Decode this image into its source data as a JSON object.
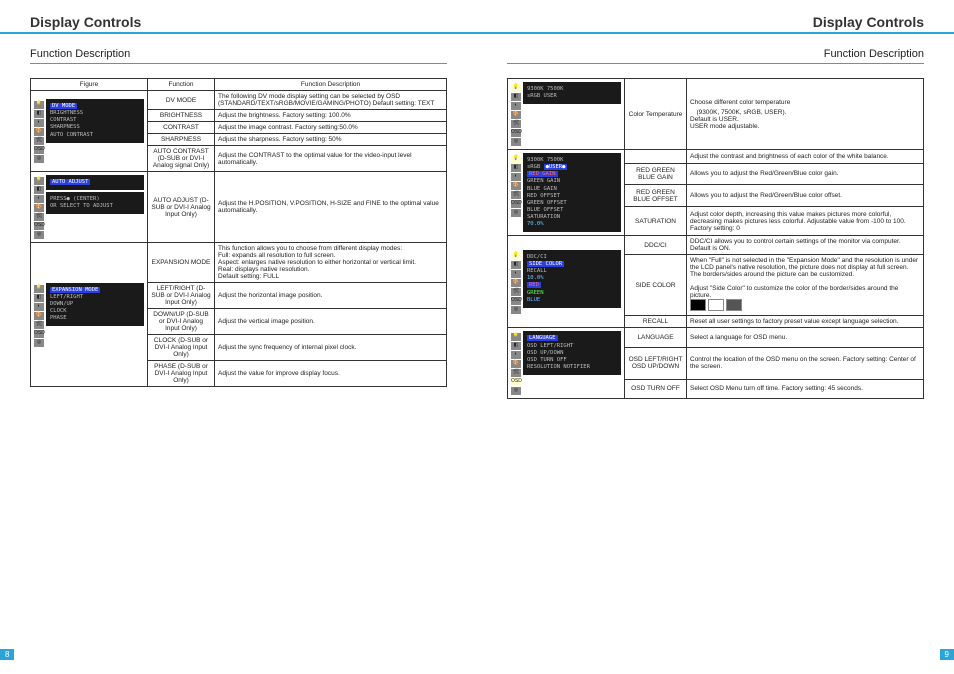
{
  "left": {
    "title": "Display Controls",
    "sub": "Function Description",
    "pnum": "8",
    "headers": [
      "Figure",
      "Function",
      "Function Description"
    ],
    "rows": [
      {
        "fn": "DV MODE",
        "desc": "The following DV mode display setting can be selected by OSD (STANDARD/TEXT/sRGB/MOVIE/GAMING/PHOTO) Default setting: TEXT"
      },
      {
        "fn": "BRIGHTNESS",
        "desc": "Adjust the brightness. Factory setting: 100.0%"
      },
      {
        "fn": "CONTRAST",
        "desc": "Adjust the image contrast. Factory setting:50.0%"
      },
      {
        "fn": "SHARPNESS",
        "desc": "Adjust the sharpness. Factory setting: 50%"
      },
      {
        "fn": "AUTO CONTRAST (D-SUB or DVI-I Analog signal Only)",
        "desc": "Adjust the CONTRAST to the optimal value for the video-input level automatically."
      },
      {
        "fn": "AUTO ADJUST (D-SUB or DVI-I Analog Input Only)",
        "desc": "Adjust the H.POSITION, V.POSITION, H-SIZE and FINE to the optimal value automatically."
      },
      {
        "fn": "EXPANSION MODE",
        "desc": "This function allows you to choose from different display modes:\nFull: expands all resolution to full screen.\nAspect: enlarges native resolution to either horizontal or vertical limit.\nReal: displays native resolution.\nDefault setting: FULL"
      },
      {
        "fn": "LEFT/RIGHT (D-SUB or DVI-I Analog Input Only)",
        "desc": "Adjust the horizontal image position."
      },
      {
        "fn": "DOWN/UP (D-SUB or DVI-I Analog Input Only)",
        "desc": "Adjust the vertical image position."
      },
      {
        "fn": "CLOCK (D-SUB or DVI-I Analog Input Only)",
        "desc": "Adjust the sync frequency of internal pixel clock."
      },
      {
        "fn": "PHASE (D-SUB or DVI-I Analog Input Only)",
        "desc": "Adjust the value for improve display focus."
      }
    ],
    "fig1": [
      "DV MODE",
      "BRIGHTNESS",
      "CONTRAST",
      "SHARPNESS",
      "AUTO CONTRAST"
    ],
    "fig2a": "AUTO ADJUST",
    "fig2b": "PRESS● (CENTER)\nOR SELECT TO ADJUST",
    "fig3": [
      "EXPANSION MODE",
      "LEFT/RIGHT",
      "DOWN/UP",
      "CLOCK",
      "PHASE"
    ]
  },
  "right": {
    "title": "Display Controls",
    "sub": "Function Description",
    "pnum": "9",
    "rows": [
      {
        "fn": "Color Temperature",
        "desc": "Choose different color temperature\n　(9300K, 7500K, sRGB, USER).\nDefault is USER.\nUSER mode adjustable."
      },
      {
        "fn": "",
        "desc": "Adjust the contrast and brightness of each color of the white balance."
      },
      {
        "fn": "RED GREEN BLUE GAIN",
        "desc": "Allows you to adjust the Red/Green/Blue color gain."
      },
      {
        "fn": "RED GREEN BLUE OFFSET",
        "desc": "Allows you to adjust the Red/Green/Blue color offset."
      },
      {
        "fn": "SATURATION",
        "desc": "Adjust color depth, increasing this value makes pictures more colorful, decreasing makes pictures less colorful. Adjustable value from -100 to 100. Factory setting: 0"
      },
      {
        "fn": "DDC/CI",
        "desc": "DDC/CI allows you to control certain settings of the monitor via computer.\nDefault is ON."
      },
      {
        "fn": "SIDE COLOR",
        "desc": "When \"Full\" is not selected in the \"Expansion Mode\" and the resolution is under the LCD panel's native resolution, the picture does not display at full screen. The borders/sides around the picture can be customized.\n\nAdjust \"Side Color\" to customize the color of the border/sides around the picture."
      },
      {
        "fn": "RECALL",
        "desc": "Reset all user settings to factory preset value except language selection."
      },
      {
        "fn": "LANGUAGE",
        "desc": "Select a language for OSD menu."
      },
      {
        "fn": "OSD LEFT/RIGHT OSD UP/DOWN",
        "desc": "Control the location of the OSD menu on the screen. Factory setting: Center of the screen."
      },
      {
        "fn": "OSD TURN OFF",
        "desc": "Select OSD Menu turn off time. Factory setting: 45 seconds."
      }
    ],
    "figA": [
      "9300K   7500K",
      "sRGB    USER"
    ],
    "figB": [
      "9300K   7500K",
      "sRGB   ",
      "RED GAIN",
      "GREEN GAIN",
      "BLUE GAIN",
      "RED OFFSET",
      "GREEN OFFSET",
      "BLUE OFFSET",
      "SATURATION",
      "        70.0%"
    ],
    "figBuser": "●USER●",
    "figC": [
      "DDC/CI",
      "SIDE COLOR",
      "RECALL",
      "        10.0%",
      "RED",
      "GREEN",
      "BLUE"
    ],
    "figD": [
      "LANGUAGE",
      "OSD LEFT/RIGHT",
      "OSD UP/DOWN",
      "OSD TURN OFF",
      "RESOLUTION NOTIFIER"
    ]
  }
}
